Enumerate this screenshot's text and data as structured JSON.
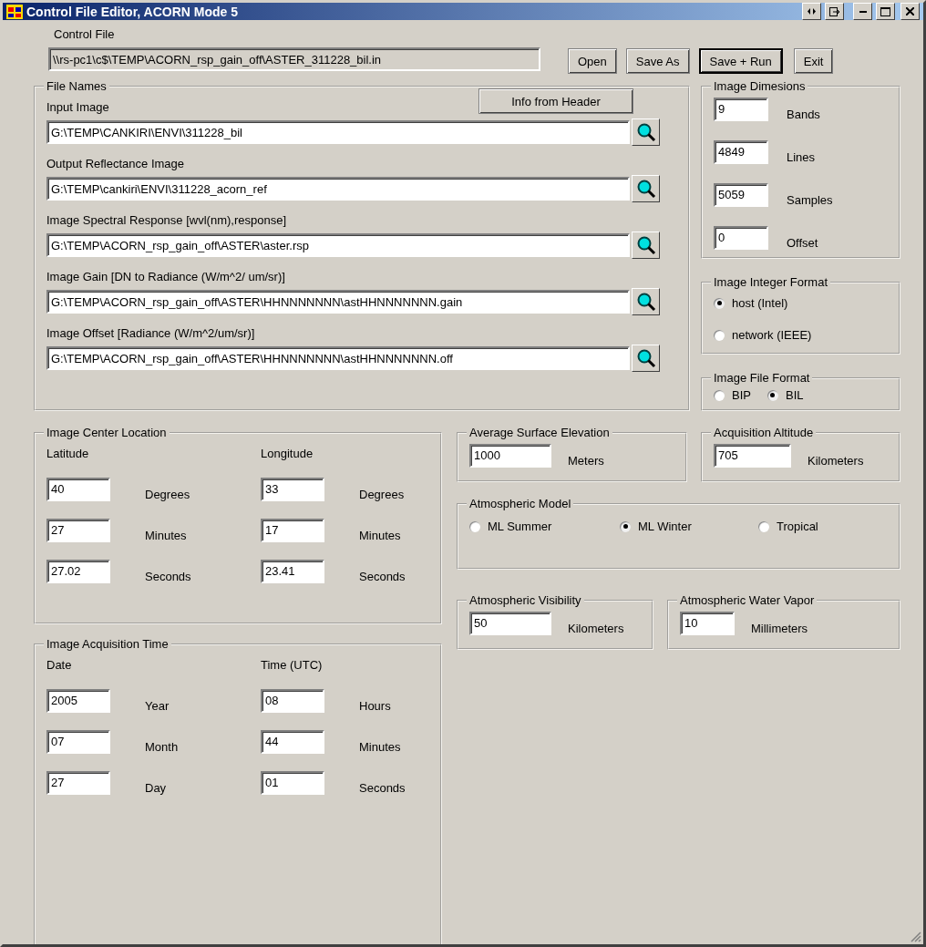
{
  "window": {
    "title": "Control File Editor, ACORN Mode 5"
  },
  "control_file": {
    "label": "Control File",
    "value": "\\\\rs-pc1\\c$\\TEMP\\ACORN_rsp_gain_off\\ASTER_311228_bil.in"
  },
  "buttons": [
    {
      "label": "Open",
      "default": false
    },
    {
      "label": "Save As",
      "default": false
    },
    {
      "label": "Save + Run",
      "default": true
    },
    {
      "label": "Exit",
      "default": false
    }
  ],
  "file_names": {
    "title": "File Names",
    "header_button": "Info from Header",
    "fields": [
      {
        "label": "Input Image",
        "value": "G:\\TEMP\\CANKIRI\\ENVI\\311228_bil"
      },
      {
        "label": "Output Reflectance Image",
        "value": "G:\\TEMP\\cankiri\\ENVI\\311228_acorn_ref"
      },
      {
        "label": "Image  Spectral Response  [wvl(nm),response]",
        "value": "G:\\TEMP\\ACORN_rsp_gain_off\\ASTER\\aster.rsp"
      },
      {
        "label": "Image Gain [DN to Radiance (W/m^2/ um/sr)]",
        "value": "G:\\TEMP\\ACORN_rsp_gain_off\\ASTER\\HHNNNNNNN\\astHHNNNNNNN.gain"
      },
      {
        "label": "Image Offset [Radiance (W/m^2/um/sr)]",
        "value": "G:\\TEMP\\ACORN_rsp_gain_off\\ASTER\\HHNNNNNNN\\astHHNNNNNNN.off"
      }
    ]
  },
  "image_dimensions": {
    "title": "Image Dimesions",
    "fields": [
      {
        "value": "9",
        "unit": "Bands"
      },
      {
        "value": "4849",
        "unit": "Lines"
      },
      {
        "value": "5059",
        "unit": "Samples"
      },
      {
        "value": "0",
        "unit": "Offset"
      }
    ]
  },
  "integer_format": {
    "title": "Image Integer Format",
    "options": [
      {
        "label": "host (Intel)",
        "selected": true
      },
      {
        "label": "network (IEEE)",
        "selected": false
      }
    ]
  },
  "file_format": {
    "title": "Image File Format",
    "options": [
      {
        "label": "BIP",
        "selected": false
      },
      {
        "label": "BIL",
        "selected": true
      }
    ]
  },
  "center_location": {
    "title": "Image Center Location",
    "columns": [
      {
        "heading": "Latitude",
        "fields": [
          {
            "value": "40",
            "unit": "Degrees"
          },
          {
            "value": "27",
            "unit": "Minutes"
          },
          {
            "value": "27.02",
            "unit": "Seconds"
          }
        ]
      },
      {
        "heading": "Longitude",
        "fields": [
          {
            "value": "33",
            "unit": "Degrees"
          },
          {
            "value": "17",
            "unit": "Minutes"
          },
          {
            "value": "23.41",
            "unit": "Seconds"
          }
        ]
      }
    ]
  },
  "acquisition_time": {
    "title": "Image Acquisition Time",
    "columns": [
      {
        "heading": "Date",
        "fields": [
          {
            "value": "2005",
            "unit": "Year"
          },
          {
            "value": "07",
            "unit": "Month"
          },
          {
            "value": "27",
            "unit": "Day"
          }
        ]
      },
      {
        "heading": "Time (UTC)",
        "fields": [
          {
            "value": "08",
            "unit": "Hours"
          },
          {
            "value": "44",
            "unit": "Minutes"
          },
          {
            "value": "01",
            "unit": "Seconds"
          }
        ]
      }
    ]
  },
  "elevation": {
    "title": "Average Surface Elevation",
    "value": "1000",
    "unit": "Meters"
  },
  "altitude": {
    "title": "Acquisition Altitude",
    "value": "705",
    "unit": "Kilometers"
  },
  "atmospheric_model": {
    "title": "Atmospheric Model",
    "options": [
      {
        "label": "ML Summer",
        "selected": false
      },
      {
        "label": "ML Winter",
        "selected": true
      },
      {
        "label": "Tropical",
        "selected": false
      }
    ]
  },
  "visibility": {
    "title": "Atmospheric Visibility",
    "value": "50",
    "unit": "Kilometers"
  },
  "water_vapor": {
    "title": "Atmospheric Water Vapor",
    "value": "10",
    "unit": "Millimeters"
  }
}
